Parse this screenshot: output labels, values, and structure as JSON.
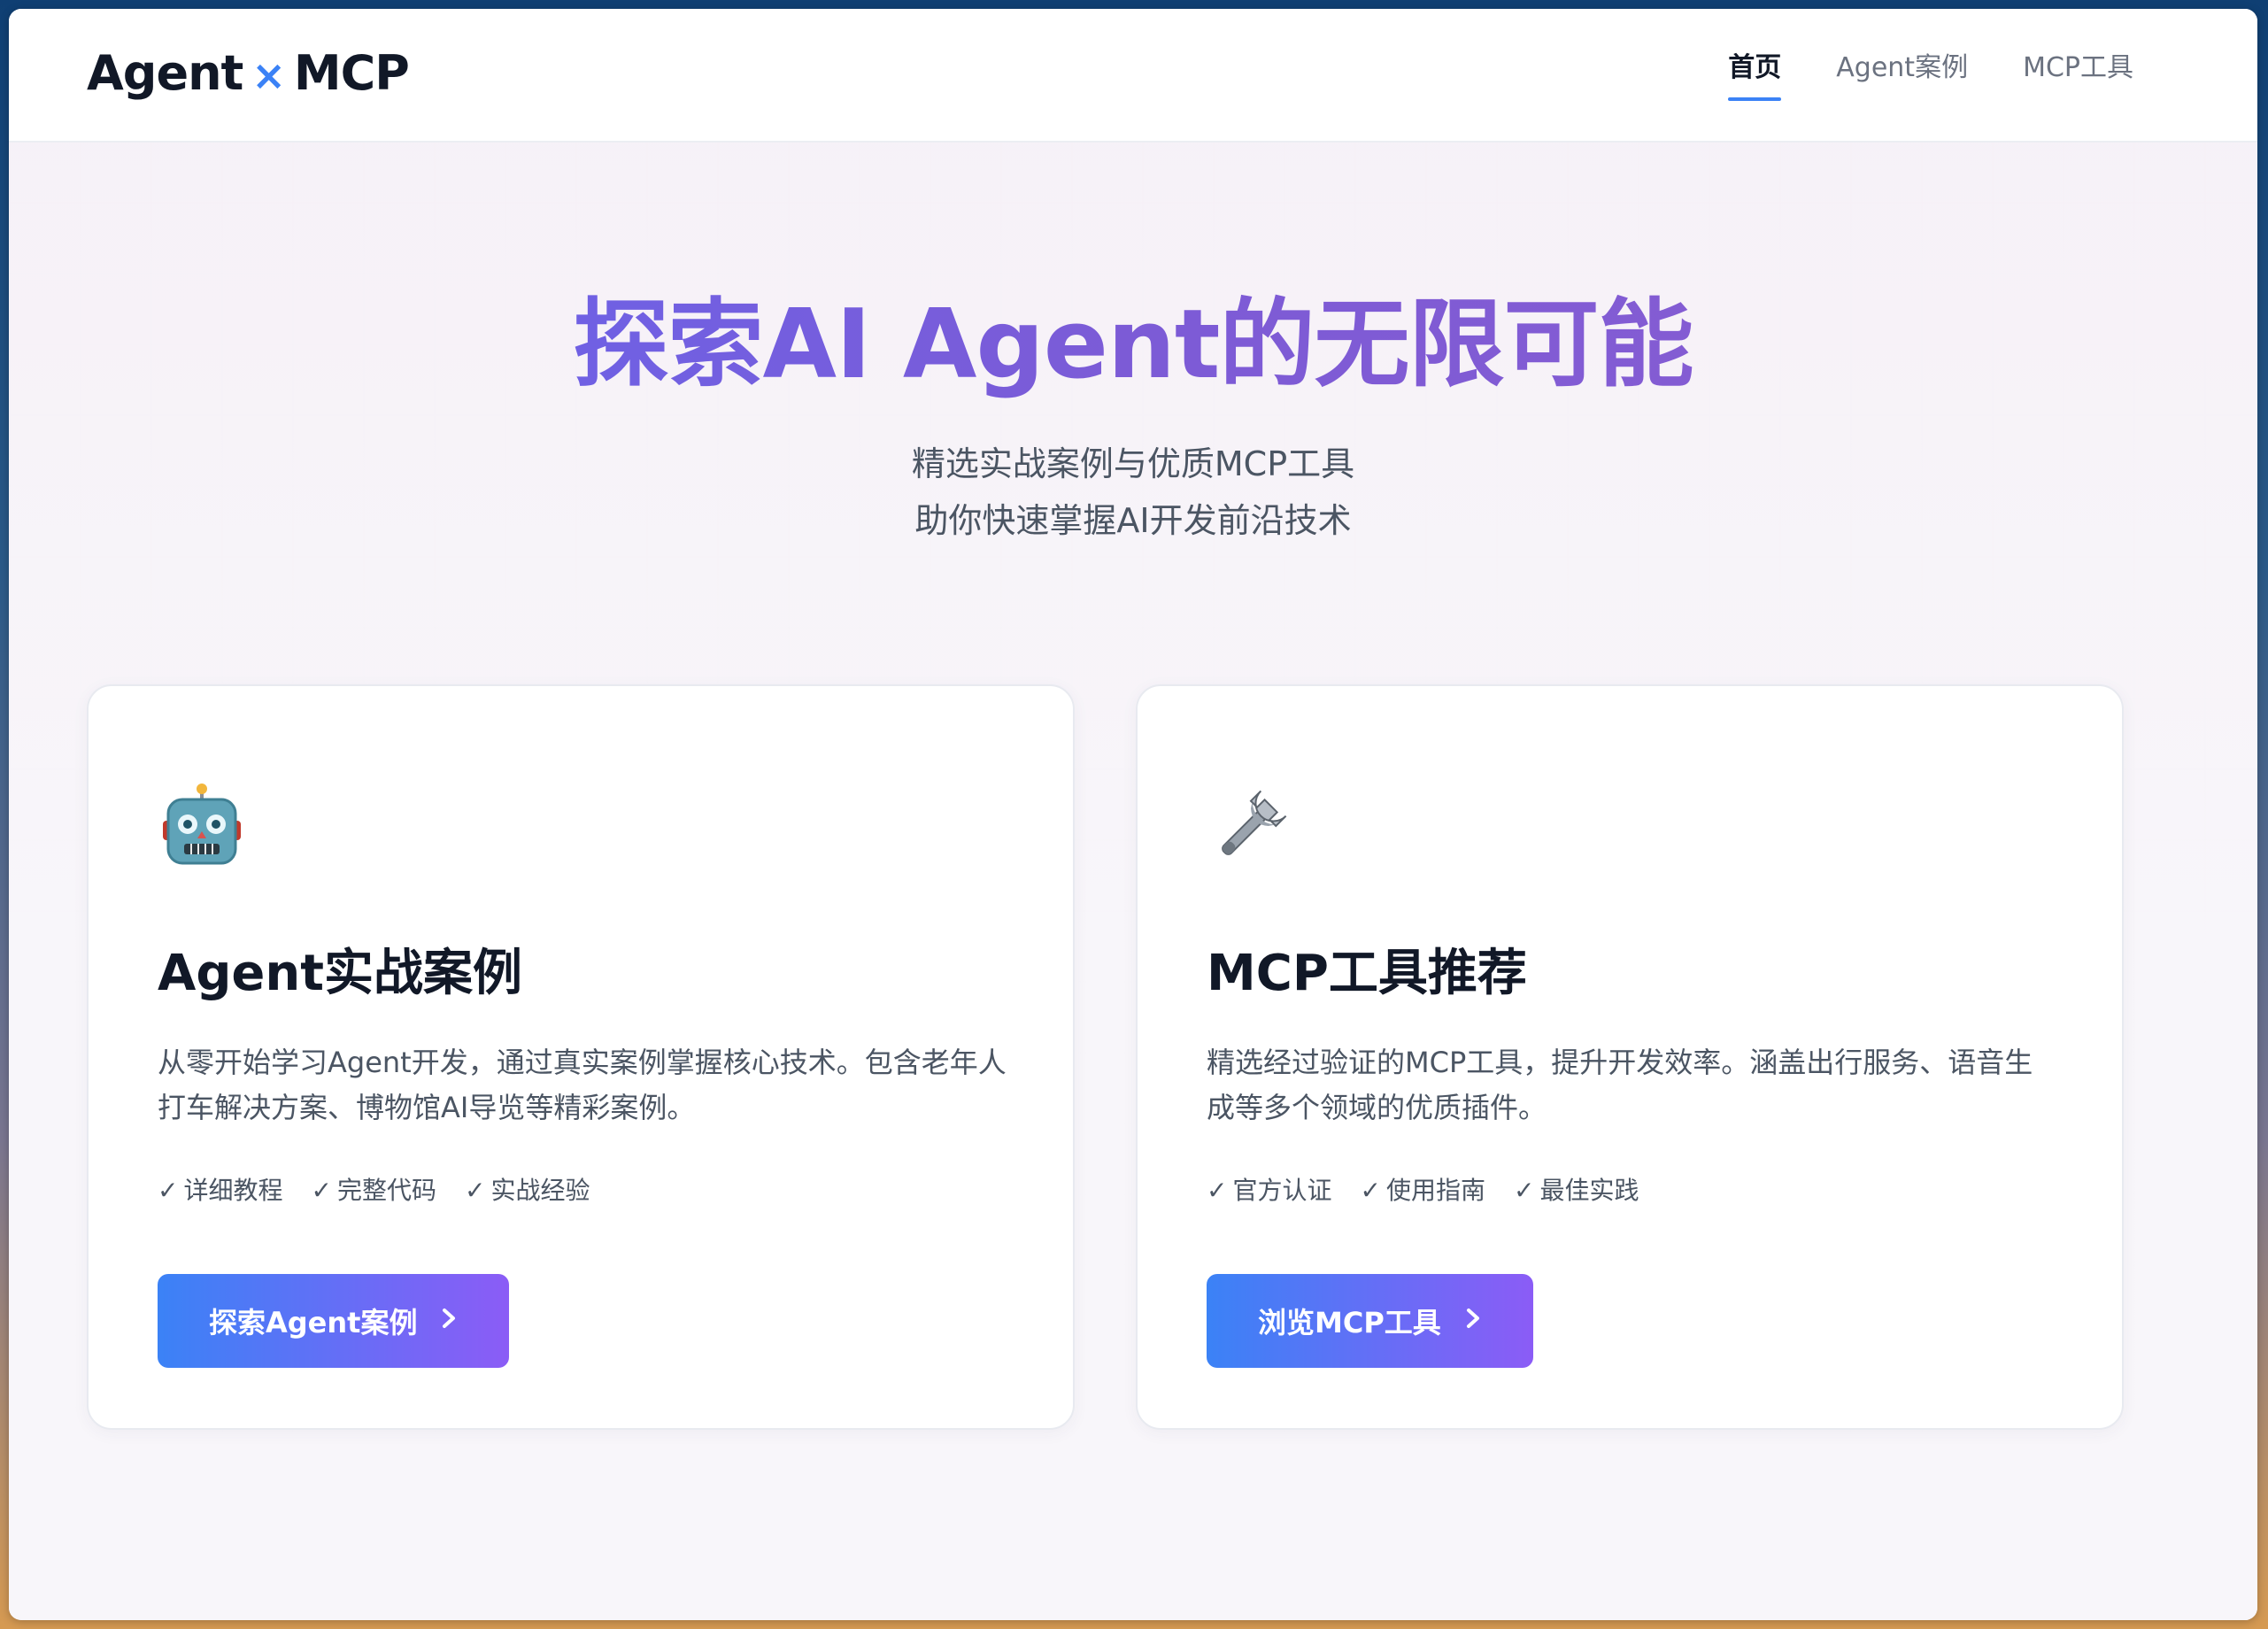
{
  "brand": {
    "part1": "Agent",
    "separator": "×",
    "part2": "MCP"
  },
  "nav": {
    "items": [
      {
        "label": "首页",
        "active": true
      },
      {
        "label": "Agent案例",
        "active": false
      },
      {
        "label": "MCP工具",
        "active": false
      }
    ]
  },
  "hero": {
    "title": "探索AI Agent的无限可能",
    "subtitle_line1": "精选实战案例与优质MCP工具",
    "subtitle_line2": "助你快速掌握AI开发前沿技术"
  },
  "cards": [
    {
      "icon": "robot-icon",
      "title": "Agent实战案例",
      "description": "从零开始学习Agent开发，通过真实案例掌握核心技术。包含老年人打车解决方案、博物馆AI导览等精彩案例。",
      "tags": [
        "详细教程",
        "完整代码",
        "实战经验"
      ],
      "button_label": "探索Agent案例"
    },
    {
      "icon": "wrench-icon",
      "title": "MCP工具推荐",
      "description": "精选经过验证的MCP工具，提升开发效率。涵盖出行服务、语音生成等多个领域的优质插件。",
      "tags": [
        "官方认证",
        "使用指南",
        "最佳实践"
      ],
      "button_label": "浏览MCP工具"
    }
  ],
  "colors": {
    "accent": "#3b82f6",
    "gradient_start": "#3b82f6",
    "gradient_end": "#8b5cf6",
    "title_gradient_start": "#6366f1",
    "title_gradient_end": "#8b5cd0"
  },
  "glyphs": {
    "check": "✓",
    "chevron": "›"
  }
}
